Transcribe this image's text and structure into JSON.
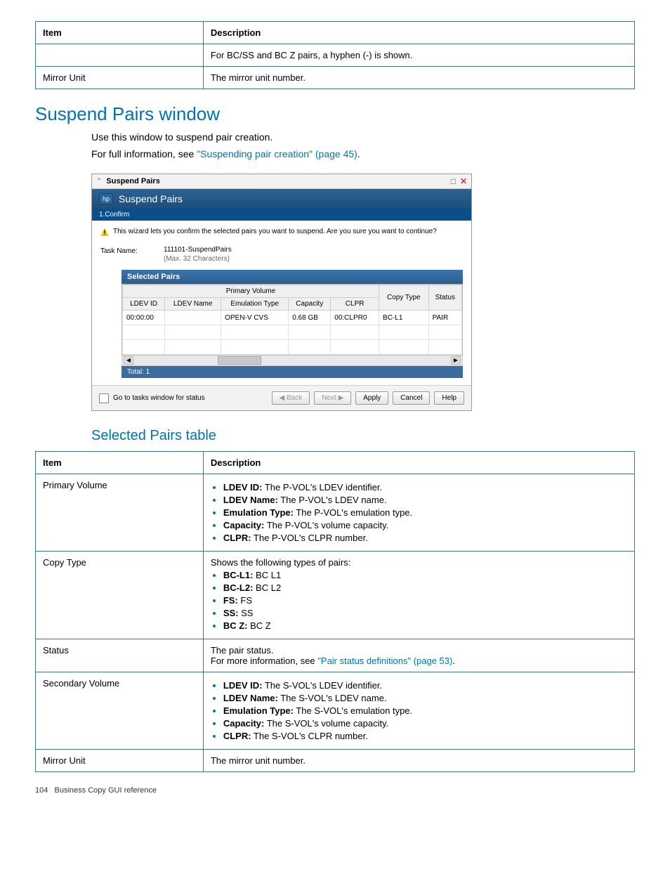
{
  "top_table": {
    "h_item": "Item",
    "h_desc": "Description",
    "row1_item": "",
    "row1_desc": "For BC/SS and BC Z pairs, a hyphen (-) is shown.",
    "row2_item": "Mirror Unit",
    "row2_desc": "The mirror unit number."
  },
  "section_title": "Suspend Pairs window",
  "intro1": "Use this window to suspend pair creation.",
  "intro2_prefix": "For full information, see ",
  "intro2_link": "\"Suspending pair creation\" (page 45)",
  "intro2_suffix": ".",
  "screenshot": {
    "window_title": "Suspend Pairs",
    "header_text": "Suspend Pairs",
    "step": "1.Confirm",
    "warn": "This wizard lets you confirm the selected pairs you want to suspend. Are you sure you want to continue?",
    "task_label": "Task Name:",
    "task_value": "111101-SuspendPairs",
    "task_max": "(Max. 32 Characters)",
    "selected_header": "Selected Pairs",
    "col_primary": "Primary Volume",
    "col_ldevid": "LDEV ID",
    "col_ldevname": "LDEV Name",
    "col_emul": "Emulation Type",
    "col_cap": "Capacity",
    "col_clpr": "CLPR",
    "col_copytype": "Copy Type",
    "col_status": "Status",
    "row_ldevid": "00:00:00",
    "row_ldevname": "",
    "row_emul": "OPEN-V CVS",
    "row_cap": "0.68 GB",
    "row_clpr": "00:CLPR0",
    "row_copytype": "BC-L1",
    "row_status": "PAIR",
    "total": "Total: 1",
    "chk_label": "Go to tasks window for status",
    "btn_back": "◀ Back",
    "btn_next": "Next ▶",
    "btn_apply": "Apply",
    "btn_cancel": "Cancel",
    "btn_help": "Help"
  },
  "subsection_title": "Selected Pairs table",
  "desc_table": {
    "h_item": "Item",
    "h_desc": "Description",
    "pv_label": "Primary Volume",
    "pv_li1_b": "LDEV ID:",
    "pv_li1_t": " The P-VOL's LDEV identifier.",
    "pv_li2_b": "LDEV Name:",
    "pv_li2_t": " The P-VOL's LDEV name.",
    "pv_li3_b": "Emulation Type:",
    "pv_li3_t": " The P-VOL's emulation type.",
    "pv_li4_b": "Capacity:",
    "pv_li4_t": " The P-VOL's volume capacity.",
    "pv_li5_b": "CLPR:",
    "pv_li5_t": " The P-VOL's CLPR number.",
    "ct_label": "Copy Type",
    "ct_intro": "Shows the following types of pairs:",
    "ct_li1_b": "BC-L1:",
    "ct_li1_t": " BC L1",
    "ct_li2_b": "BC-L2:",
    "ct_li2_t": " BC L2",
    "ct_li3_b": "FS:",
    "ct_li3_t": " FS",
    "ct_li4_b": "SS:",
    "ct_li4_t": " SS",
    "ct_li5_b": "BC Z:",
    "ct_li5_t": " BC Z",
    "st_label": "Status",
    "st_l1": "The pair status.",
    "st_l2a": "For more information, see ",
    "st_link": "\"Pair status definitions\" (page 53)",
    "st_l2b": ".",
    "sv_label": "Secondary Volume",
    "sv_li1_b": "LDEV ID:",
    "sv_li1_t": " The S-VOL's LDEV identifier.",
    "sv_li2_b": "LDEV Name:",
    "sv_li2_t": " The S-VOL's LDEV name.",
    "sv_li3_b": "Emulation Type:",
    "sv_li3_t": " The S-VOL's emulation type.",
    "sv_li4_b": "Capacity:",
    "sv_li4_t": " The S-VOL's volume capacity.",
    "sv_li5_b": "CLPR:",
    "sv_li5_t": " The S-VOL's CLPR number.",
    "mu_label": "Mirror Unit",
    "mu_desc": "The mirror unit number."
  },
  "footer": {
    "page": "104",
    "chapter": "Business Copy GUI reference"
  }
}
